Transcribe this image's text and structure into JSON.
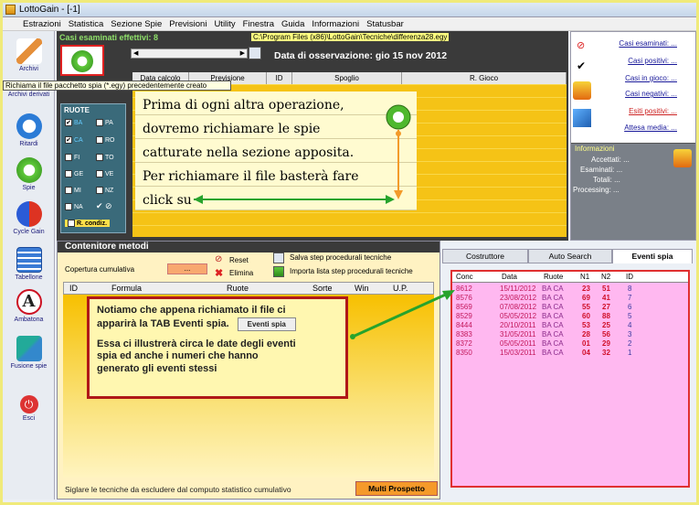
{
  "window": {
    "title": "LottoGain - [-1]"
  },
  "menu": [
    "Estrazioni",
    "Statistica",
    "Sezione Spie",
    "Previsioni",
    "Utility",
    "Finestra",
    "Guida",
    "Informazioni",
    "Statusbar"
  ],
  "sidebar": {
    "items": [
      "Archivi",
      "Archivi derivati",
      "Ritardi",
      "Spie",
      "Cycle Gain",
      "Tabellone",
      "Ambatona",
      "Fusione spie",
      "Esci"
    ]
  },
  "tooltip": "Richiama il file pacchetto spia (*.egy) precedentemente creato",
  "top": {
    "casi_label": "Casi esaminati effettivi: 8",
    "path": "C:\\Program Files (x86)\\LottoGain\\Tecniche\\differenza28.egy",
    "data_oss": "Data di osservazione:  gio 15 nov 2012"
  },
  "grid_headers": [
    "Data calcolo",
    "Previsione",
    "ID",
    "Spoglio",
    "R. Gioco"
  ],
  "ruote": {
    "title": "RUOTE",
    "items": [
      "BA",
      "PA",
      "CA",
      "RO",
      "FI",
      "TO",
      "GE",
      "VE",
      "MI",
      "NZ",
      "NA"
    ],
    "condiz": "R. condiz."
  },
  "note1": [
    "Prima di ogni altra operazione,",
    "dovremo richiamare le spie",
    "catturate nella sezione apposita.",
    "Per richiamare il file basterà fare",
    "click su"
  ],
  "right": {
    "items": [
      "Casi esaminati: ...",
      "Casi positivi: ...",
      "Casi in gioco: ...",
      "Casi negativi: ...",
      "Esiti positivi: ...",
      "Attesa media: ..."
    ],
    "info_title": "Informazioni",
    "info": [
      "Accettati: ...",
      "Esaminati: ...",
      "Totali: ...",
      "Processing: ..."
    ]
  },
  "contenitore": {
    "title": "Contenitore metodi",
    "reset": "Reset",
    "elimina": "Elimina",
    "salva": "Salva step procedurali tecniche",
    "importa": "Importa lista step procedurali tecniche",
    "copertura": "Copertura cumulativa",
    "copertura_val": "...",
    "cols": [
      "ID",
      "Formula",
      "Ruote",
      "Sorte",
      "Win",
      "U.P."
    ],
    "footer": "Siglare le tecniche da escludere dal computo statistico cumulativo",
    "multi": "Multi Prospetto"
  },
  "note2": {
    "line1": "Notiamo che appena richiamato il file ci",
    "line2": "apparirà la TAB Eventi spia.",
    "btn": "Eventi spia",
    "line3": "Essa ci illustrerà circa le date degli eventi",
    "line4": "spia ed anche i numeri che hanno",
    "line5": "generato gli eventi stessi"
  },
  "tabs": [
    "Costruttore",
    "Auto Search",
    "Eventi spia"
  ],
  "events": {
    "cols": [
      "Conc",
      "Data",
      "Ruote",
      "N1",
      "N2",
      "ID"
    ],
    "rows": [
      [
        "8612",
        "15/11/2012",
        "BA CA",
        "23",
        "51",
        "8"
      ],
      [
        "8576",
        "23/08/2012",
        "BA CA",
        "69",
        "41",
        "7"
      ],
      [
        "8569",
        "07/08/2012",
        "BA CA",
        "55",
        "27",
        "6"
      ],
      [
        "8529",
        "05/05/2012",
        "BA CA",
        "60",
        "88",
        "5"
      ],
      [
        "8444",
        "20/10/2011",
        "BA CA",
        "53",
        "25",
        "4"
      ],
      [
        "8383",
        "31/05/2011",
        "BA CA",
        "28",
        "56",
        "3"
      ],
      [
        "8372",
        "05/05/2011",
        "BA CA",
        "01",
        "29",
        "2"
      ],
      [
        "8350",
        "15/03/2011",
        "BA CA",
        "04",
        "32",
        "1"
      ]
    ]
  },
  "colors": {
    "accent_green": "#27a32c",
    "yellow_grid": "#f5c316",
    "event_pink": "#ffb8f0",
    "note_border": "#b01818"
  }
}
